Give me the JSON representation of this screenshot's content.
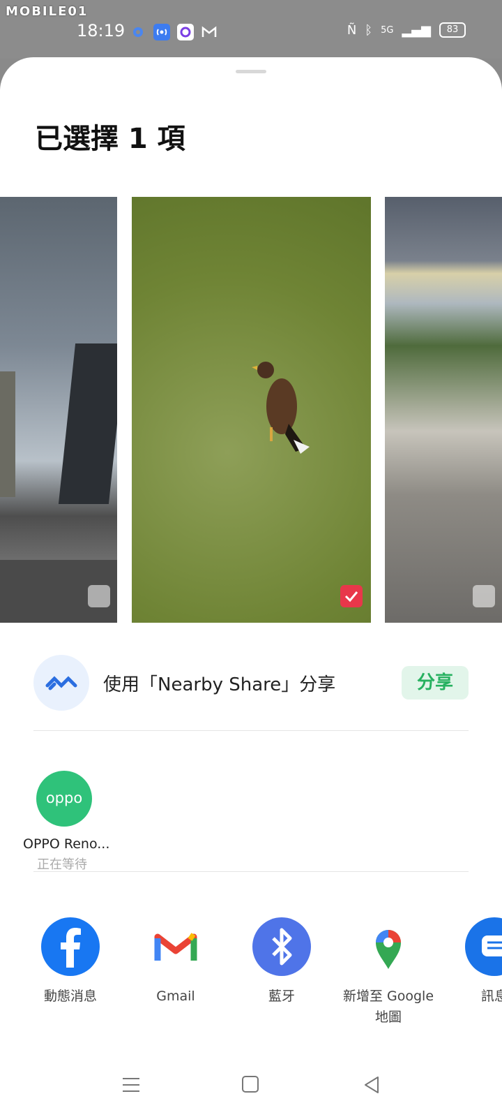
{
  "status_bar": {
    "watermark": "MOBILE01",
    "time": "18:19",
    "network": "5G",
    "battery": "83"
  },
  "sheet": {
    "title": "已選擇 1 項"
  },
  "nearby": {
    "label": "使用「Nearby Share」分享",
    "button": "分享"
  },
  "device": {
    "icon_text": "oppo",
    "name": "OPPO Reno...",
    "status": "正在等待"
  },
  "apps": [
    {
      "label": "動態消息",
      "icon": "facebook-icon"
    },
    {
      "label": "Gmail",
      "icon": "gmail-icon"
    },
    {
      "label": "藍牙",
      "icon": "bluetooth-icon"
    },
    {
      "label": "新增至 Google\n地圖",
      "icon": "google-maps-icon"
    },
    {
      "label": "訊息",
      "icon": "messages-icon"
    }
  ],
  "colors": {
    "accent_green": "#27b160",
    "check_red": "#e8374a",
    "facebook_blue": "#1877f2",
    "bluetooth_blue": "#4f74e8"
  }
}
